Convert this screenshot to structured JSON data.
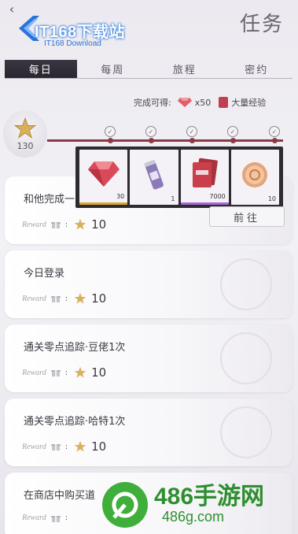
{
  "header": {
    "title": "任务",
    "logo_main": "IT168下载站",
    "logo_sub": "IT168 Download"
  },
  "tabs": [
    {
      "label": "每日",
      "active": true
    },
    {
      "label": "每周",
      "active": false
    },
    {
      "label": "旅程",
      "active": false
    },
    {
      "label": "密约",
      "active": false
    }
  ],
  "completion": {
    "label": "完成可得:",
    "gem_amount": "x50",
    "exp_label": "大量经验"
  },
  "progress": {
    "points": "130",
    "milestones_claimed": 5
  },
  "popup": {
    "items": [
      {
        "name": "diamond",
        "count": "30",
        "rarity": "gold"
      },
      {
        "name": "can",
        "count": "1",
        "rarity": "none"
      },
      {
        "name": "exp-book",
        "count": "7000",
        "rarity": "purple"
      },
      {
        "name": "coin",
        "count": "10",
        "rarity": "none"
      }
    ]
  },
  "go_button": "前往",
  "reward_label": "Reward",
  "tasks": [
    {
      "name": "和他完成一",
      "reward": "10"
    },
    {
      "name": "今日登录",
      "reward": "10"
    },
    {
      "name": "通关零点追踪·豆佬1次",
      "reward": "10"
    },
    {
      "name": "通关零点追踪·哈特1次",
      "reward": "10"
    },
    {
      "name": "在商店中购买道",
      "reward": ""
    }
  ],
  "watermark": {
    "main": "486手游网",
    "sub": "486g.com"
  },
  "colors": {
    "accent": "#8a3a44",
    "tab_active": "#2f2b35",
    "watermark": "#2d8f2f"
  }
}
